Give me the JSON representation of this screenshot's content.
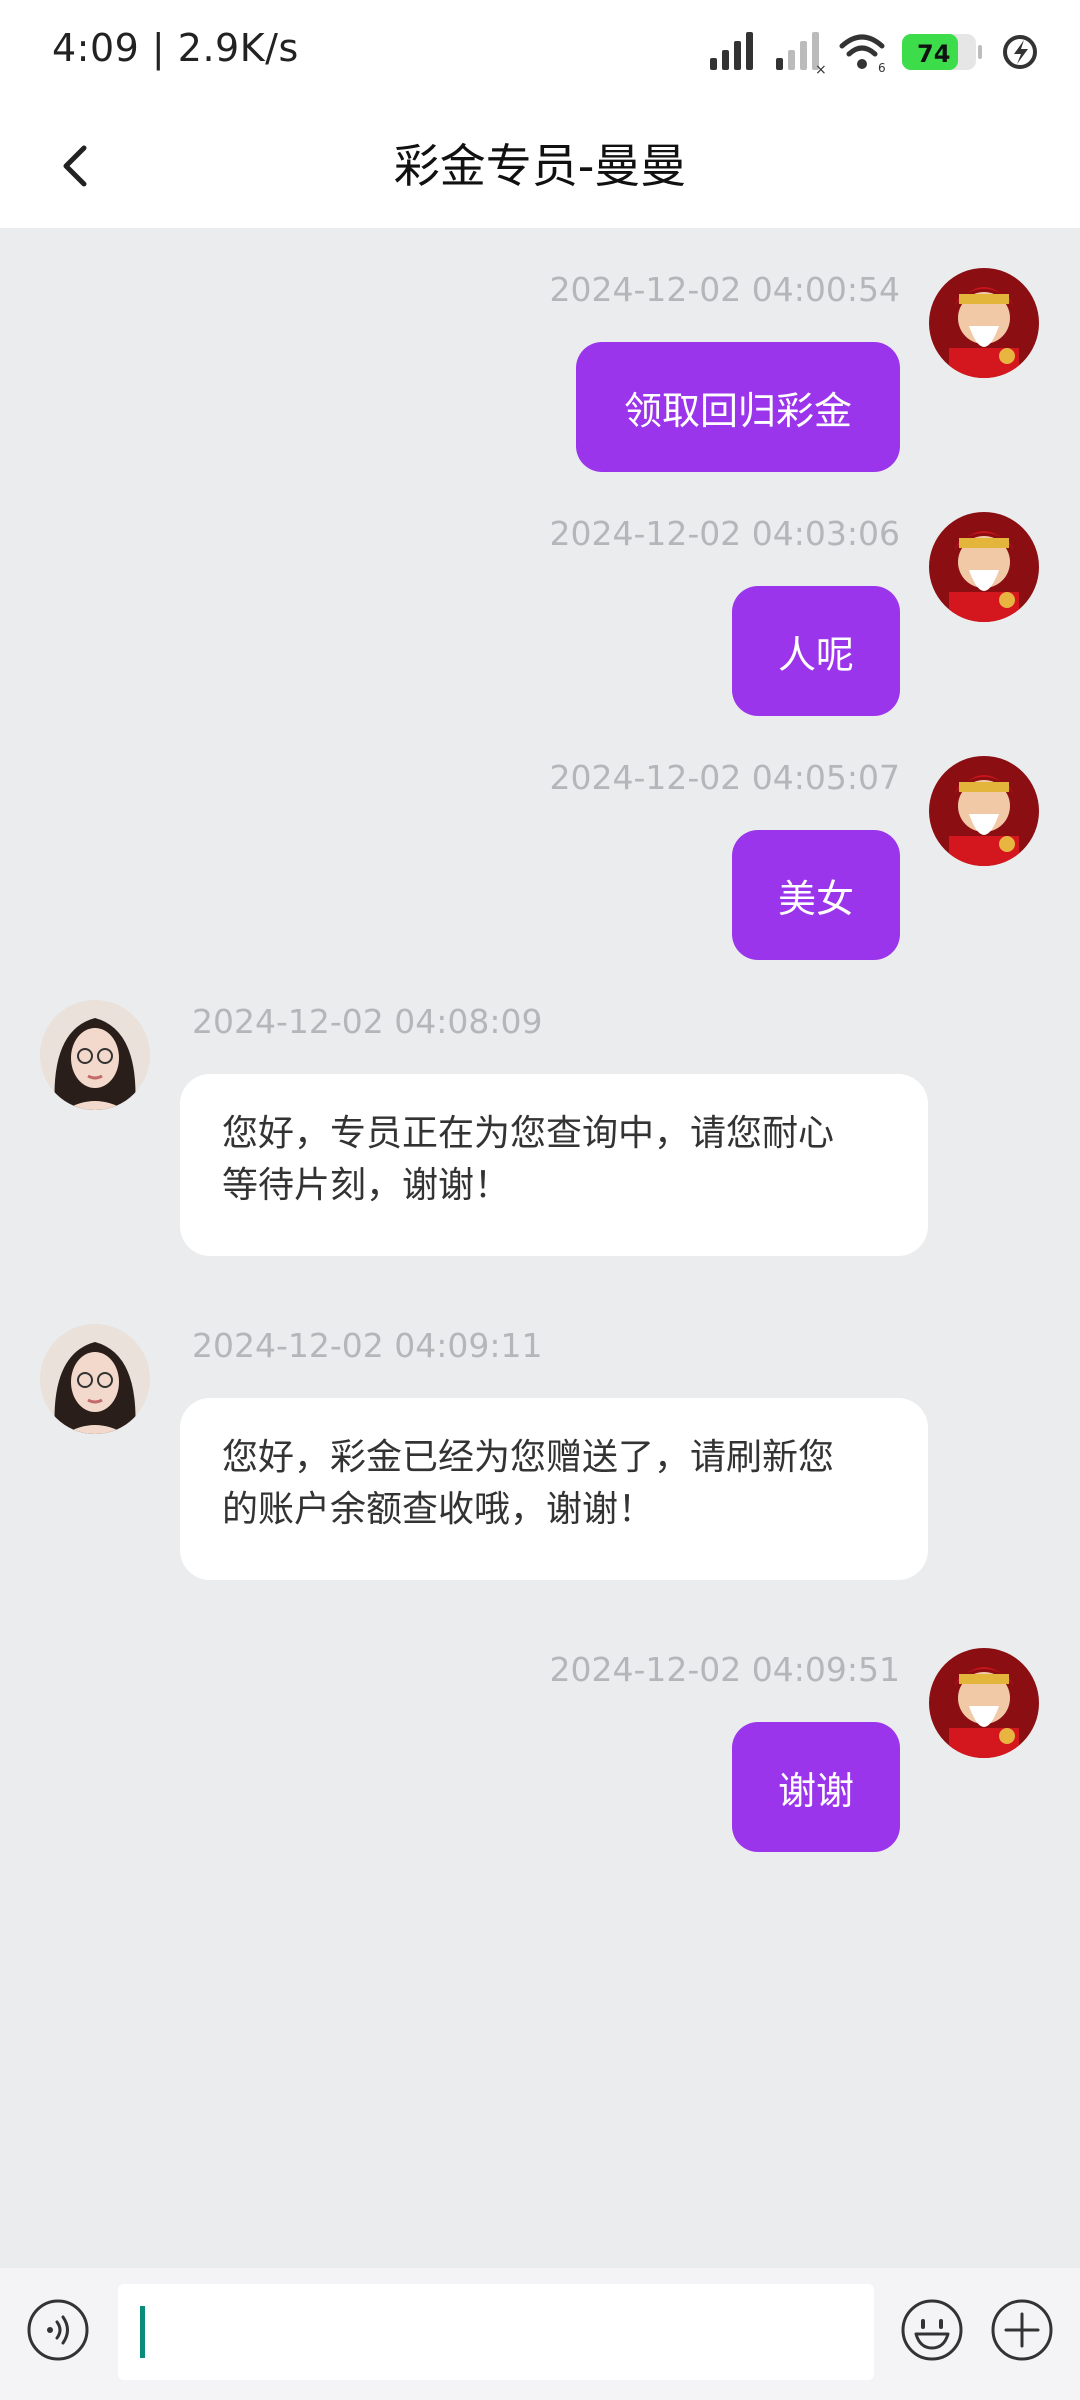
{
  "status_bar": {
    "time": "4:09 | 2.9K/s",
    "battery": "74"
  },
  "header": {
    "title": "彩金专员-曼曼"
  },
  "messages": [
    {
      "side": "out",
      "timestamp": "2024-12-02 04:00:54",
      "text": "领取回归彩金"
    },
    {
      "side": "out",
      "timestamp": "2024-12-02 04:03:06",
      "text": "人呢"
    },
    {
      "side": "out",
      "timestamp": "2024-12-02 04:05:07",
      "text": "美女"
    },
    {
      "side": "in",
      "timestamp": "2024-12-02 04:08:09",
      "line1": "您好，专员正在为您查询中，请您耐心",
      "line2": "等待片刻，谢谢！"
    },
    {
      "side": "in",
      "timestamp": "2024-12-02 04:09:11",
      "line1": "您好，彩金已经为您赠送了，请刷新您",
      "line2": "的账户余额查收哦，谢谢！"
    },
    {
      "side": "out",
      "timestamp": "2024-12-02 04:09:51",
      "text": "谢谢"
    }
  ],
  "input": {
    "value": ""
  },
  "colors": {
    "accent": "#9B35EC",
    "background": "#EBECEE",
    "battery": "#3DDC4B"
  }
}
